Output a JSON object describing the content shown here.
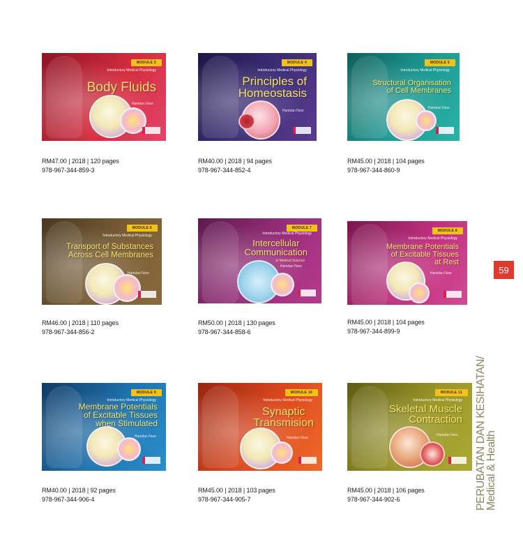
{
  "page_number": "59",
  "sidebar": {
    "line1": "PERUBATAN DAN KESIHATAN/",
    "line2": "Medical & Health"
  },
  "books": [
    {
      "module": "MODULE 3",
      "series": "Introductory Medical Physiology",
      "title": "Body Fluids",
      "author": "Hamdan Noor",
      "price_line": "RM47.00  |  2018  |  120 pages",
      "isbn": "978-967-344-859-3",
      "cover_color": "#c0283a"
    },
    {
      "module": "MODULE 4",
      "series": "Introductory Medical Physiology",
      "title": "Principles of\nHomeostasis",
      "author": "Hamdan Noor",
      "price_line": "RM40.00  |  2018  |  94 pages",
      "isbn": "978-967-344-852-4",
      "cover_color": "#3a2c6e"
    },
    {
      "module": "MODULE 5",
      "series": "Introductory Medical Physiology",
      "title": "Structural Organisation\nof Cell Membranes",
      "author": "Hamdan Noor",
      "price_line": "RM45.00  |  2018  |  104 pages",
      "isbn": "978-967-344-860-9",
      "cover_color": "#1f8f8a"
    },
    {
      "module": "MODULE 6",
      "series": "Introductory Medical Physiology",
      "title": "Transport of Substances\nAcross Cell Membranes",
      "author": "Hamdan Noor",
      "price_line": "RM46.00  |  2018  |  110 pages",
      "isbn": "978-967-344-856-2",
      "cover_color": "#6e5630"
    },
    {
      "module": "MODULE 7",
      "series": "Introductory Medical Physiology",
      "title": "Intercellular\nCommunication",
      "subtitle": "in Medical Science",
      "author": "Hamdan Noor",
      "price_line": "RM50.00  |  2018  |  130 pages",
      "isbn": "978-967-344-858-6",
      "cover_color": "#8e2a6e"
    },
    {
      "module": "MODULE 8",
      "series": "Introductory Medical Physiology",
      "title": "Membrane Potentials\nof Excitable Tissues\nat Rest",
      "author": "Hamdan Noor",
      "price_line": "RM45.00  |  2018  |  104 pages",
      "isbn": "978-967-344-899-9",
      "cover_color": "#b02a78"
    },
    {
      "module": "MODULE 9",
      "series": "Introductory Medical Physiology",
      "title": "Membrane Potentials\nof Excitable Tissues\nwhen Stimulated",
      "author": "Hamdan Noor",
      "price_line": "RM40.00  |  2018  |  92 pages",
      "isbn": "978-967-344-906-4",
      "cover_color": "#1f6ea8"
    },
    {
      "module": "MODULE 10",
      "series": "Introductory Medical Physiology",
      "title": "Synaptic\nTransmision",
      "author": "Hamdan Noor",
      "price_line": "RM45.00  |  2018  |  103 pages",
      "isbn": "978-967-344-905-7",
      "cover_color": "#d8451e"
    },
    {
      "module": "MODULE 11",
      "series": "Introductory Medical Physiology",
      "title": "Skeletal Muscle\nContraction",
      "author": "Hamdan Noor",
      "price_line": "RM45.00  |  2018  |  106 pages",
      "isbn": "978-967-344-902-6",
      "cover_color": "#8e8a26"
    }
  ]
}
